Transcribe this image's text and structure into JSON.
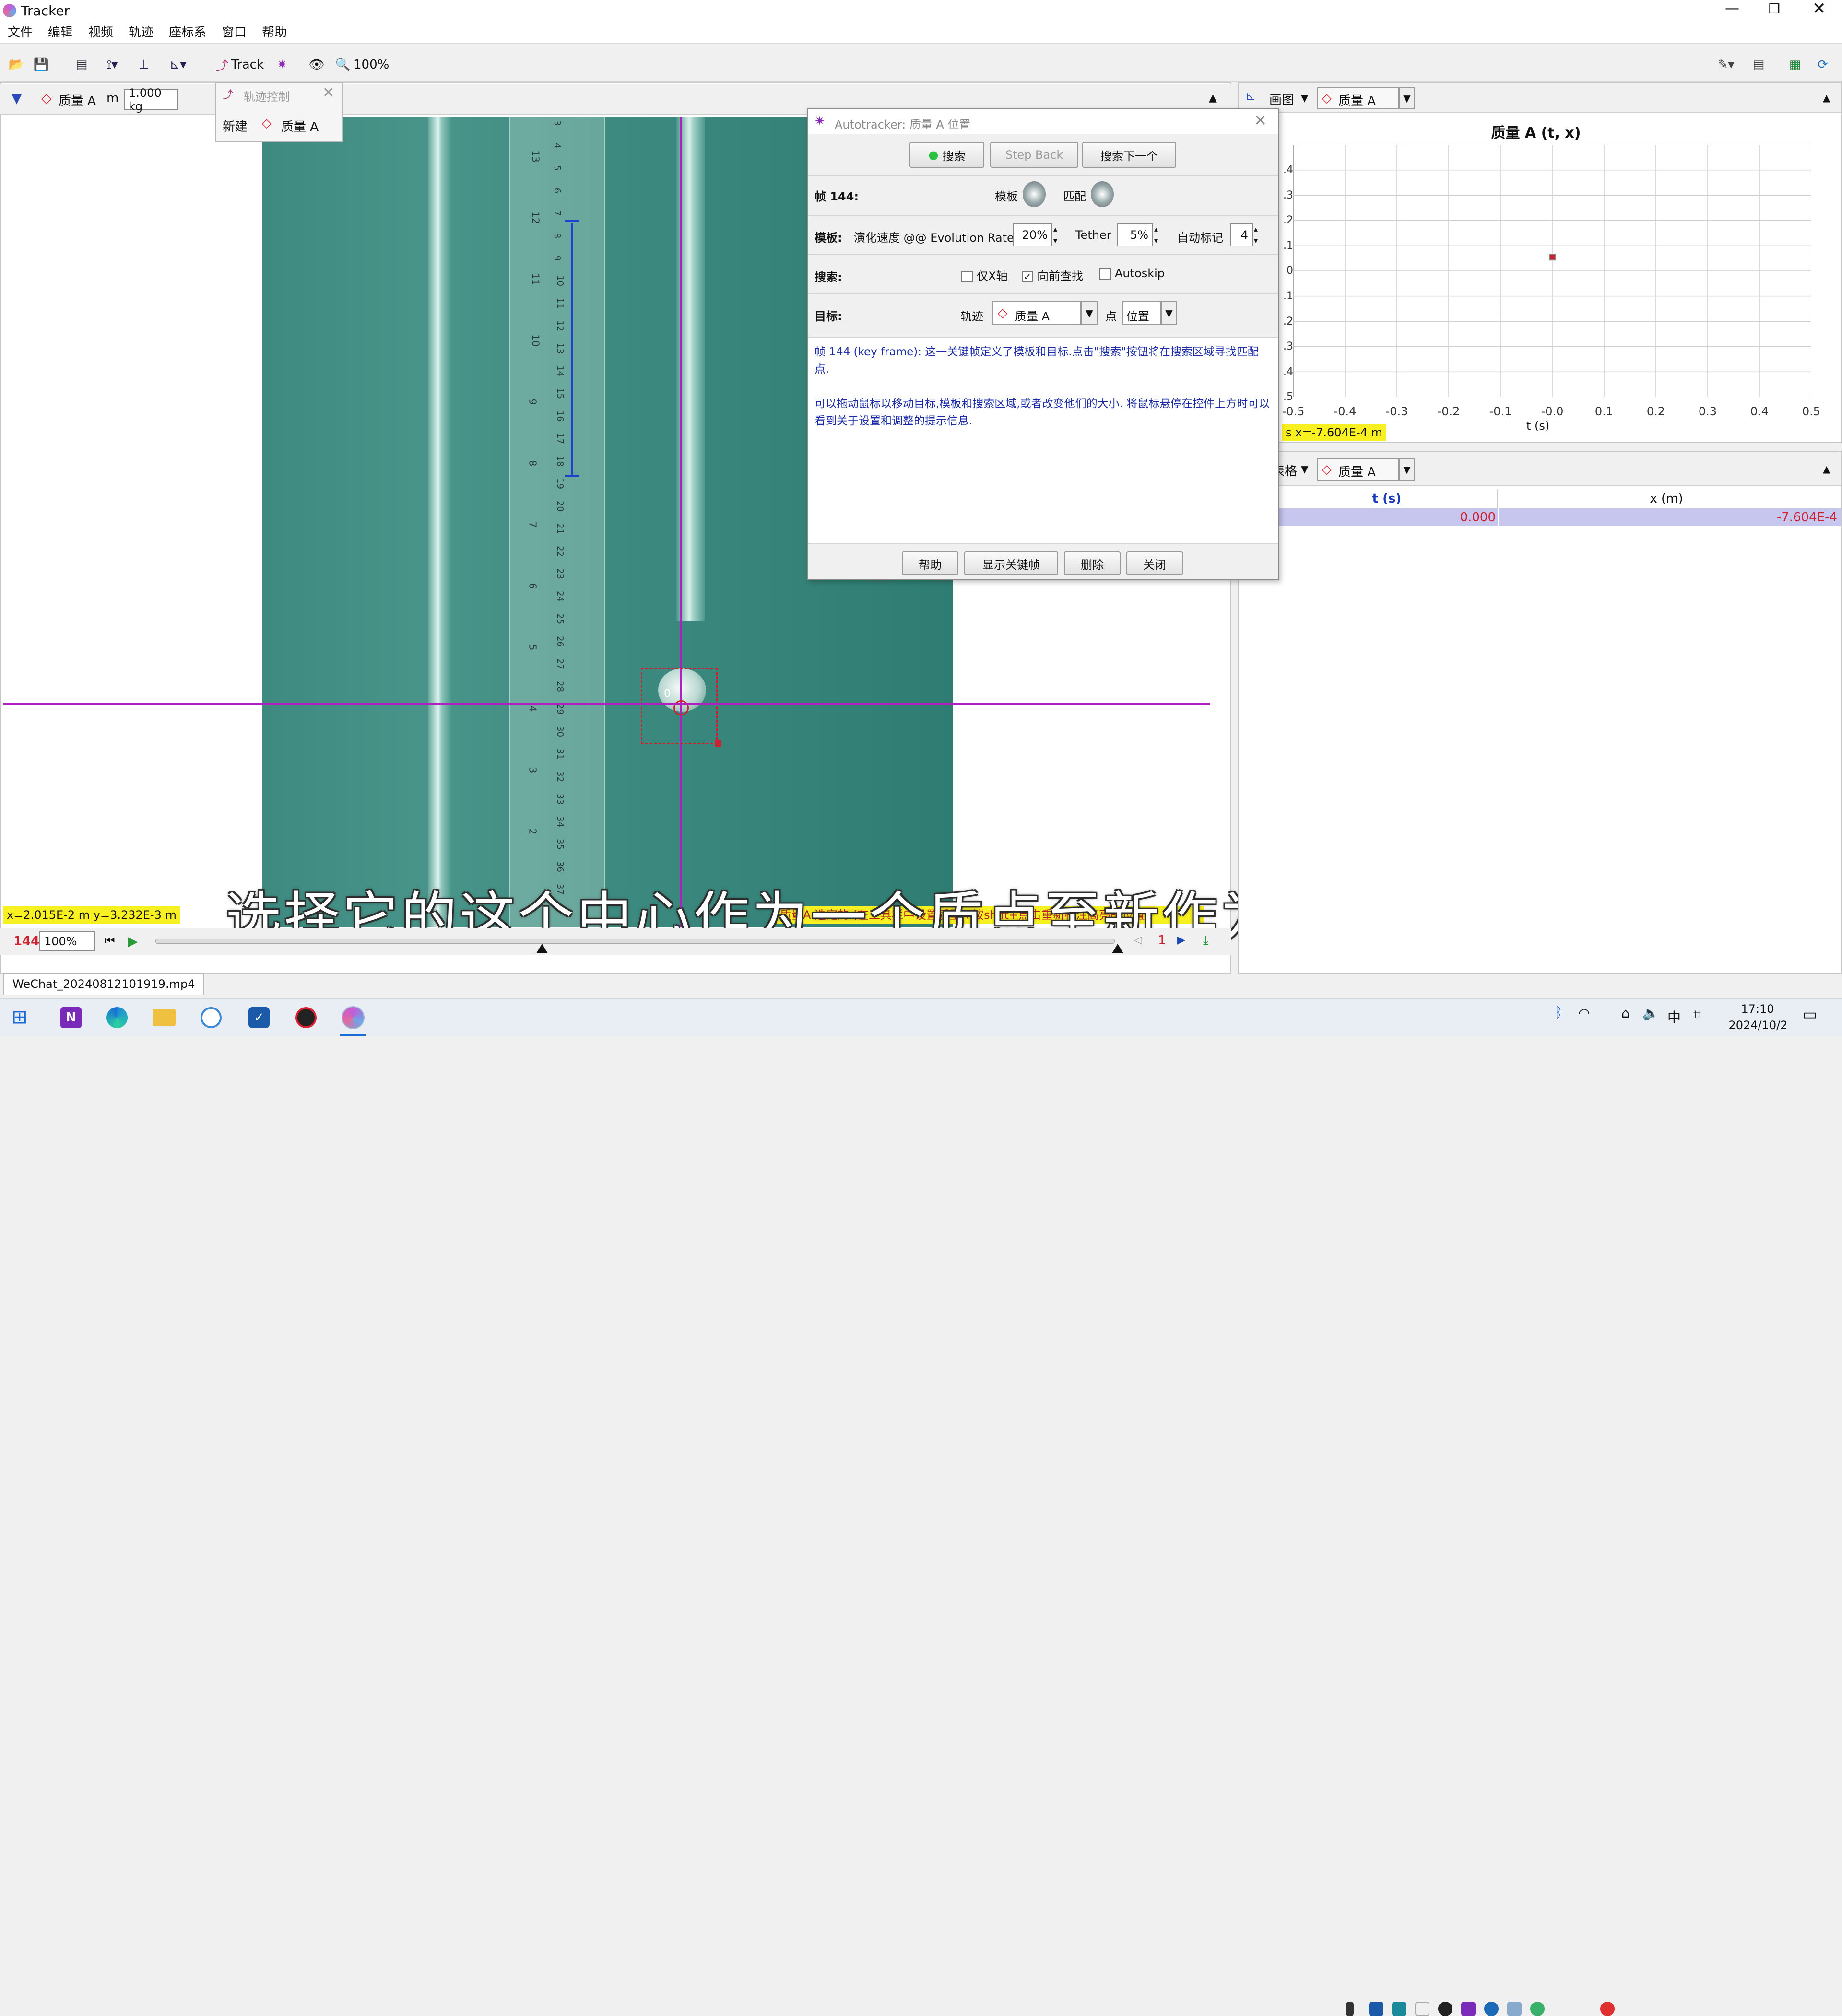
{
  "app": {
    "title": "Tracker",
    "window_controls": [
      "minimize",
      "restore",
      "close"
    ]
  },
  "menu": [
    "文件",
    "编辑",
    "视频",
    "轨迹",
    "座标系",
    "窗口",
    "帮助"
  ],
  "toolbar": {
    "track_label": "Track",
    "zoom": "100%"
  },
  "track_bar": {
    "track_name": "质量 A",
    "mass_label": "m",
    "mass_value": "1.000 kg"
  },
  "track_control": {
    "title": "轨迹控制",
    "new_label": "新建",
    "track_name": "质量 A"
  },
  "ruler_labels": [
    "3",
    "4",
    "5",
    "6",
    "7",
    "8",
    "9",
    "10",
    "11",
    "12",
    "13",
    "14",
    "15",
    "16",
    "17",
    "18",
    "19",
    "20",
    "21",
    "22",
    "23",
    "24",
    "25",
    "26",
    "27",
    "28",
    "29",
    "30",
    "31",
    "32",
    "33",
    "34",
    "35",
    "36",
    "37"
  ],
  "ruler_labels_left": [
    "13",
    "12",
    "11",
    "10",
    "9",
    "8",
    "7",
    "6",
    "5",
    "4",
    "3",
    "2"
  ],
  "video": {
    "marker_label": "0",
    "coord_readout": "x=2.015E-2 m  y=3.232E-3 m",
    "hint_text": "质量A 选定的 (在工具栏中设置质量A 按shift+点击重新标注高亮的位置)",
    "subtitle": "选择它的这个中心作为一个质点至新作为一个追踪嗯"
  },
  "player": {
    "frame": "144",
    "rate": "100%"
  },
  "file_tab": "WeChat_20240812101919.mp4",
  "autotracker": {
    "title": "Autotracker: 质量 A 位置",
    "search_btn": "搜索",
    "step_back_btn": "Step Back",
    "search_next_btn": "搜索下一个",
    "frame_label": "帧 144:",
    "template_label": "模板",
    "match_label": "匹配",
    "template_row_label": "模板:",
    "evolution_label": "演化速度 @@ Evolution Rate",
    "evolution_value": "20%",
    "tether_label": "Tether",
    "tether_value": "5%",
    "automark_label": "自动标记",
    "automark_value": "4",
    "search_row_label": "搜索:",
    "x_only": "仅X轴",
    "look_ahead": "向前查找",
    "autoskip": "Autoskip",
    "target_row_label": "目标:",
    "track_label": "轨迹",
    "track_value": "质量 A",
    "point_label": "点",
    "point_value": "位置",
    "info_text_1": "帧 144 (key frame): 这一关键帧定义了模板和目标.点击\"搜索\"按钮将在搜索区域寻找匹配点.",
    "info_text_2": "可以拖动鼠标以移动目标,模板和搜索区域,或者改变他们的大小. 将鼠标悬停在控件上方时可以看到关于设置和调整的提示信息.",
    "help_btn": "帮助",
    "show_keyframe_btn": "显示关键帧",
    "delete_btn": "删除",
    "close_btn": "关闭"
  },
  "plot": {
    "view_label": "画图",
    "track_name": "质量 A",
    "title": "质量 A (t, x)",
    "x_ticks": [
      "-0.5",
      "-0.4",
      "-0.3",
      "-0.2",
      "-0.1",
      "-0.0",
      "0.1",
      "0.2",
      "0.3",
      "0.4",
      "0.5"
    ],
    "y_ticks": [
      ".4",
      ".3",
      ".2",
      ".1",
      "0",
      ".1",
      ".2",
      ".3",
      ".4",
      ".5"
    ],
    "xlabel": "t (s)",
    "readout": "s  x=-7.604E-4 m"
  },
  "table": {
    "view_label": "表格",
    "track_name": "质量 A",
    "headers": [
      "t (s)",
      "x (m)"
    ],
    "rows": [
      [
        "0.000",
        "-7.604E-4"
      ]
    ]
  },
  "chart_data": {
    "type": "scatter",
    "title": "质量 A (t, x)",
    "xlabel": "t (s)",
    "ylabel": "",
    "xlim": [
      -0.5,
      0.5
    ],
    "ylim": [
      -0.5,
      0.4
    ],
    "points": [
      {
        "x": 0.0,
        "y": -0.00076
      }
    ],
    "grid": true
  },
  "taskbar": {
    "time": "17:10",
    "date": "2024/10/2",
    "ime": "中"
  }
}
